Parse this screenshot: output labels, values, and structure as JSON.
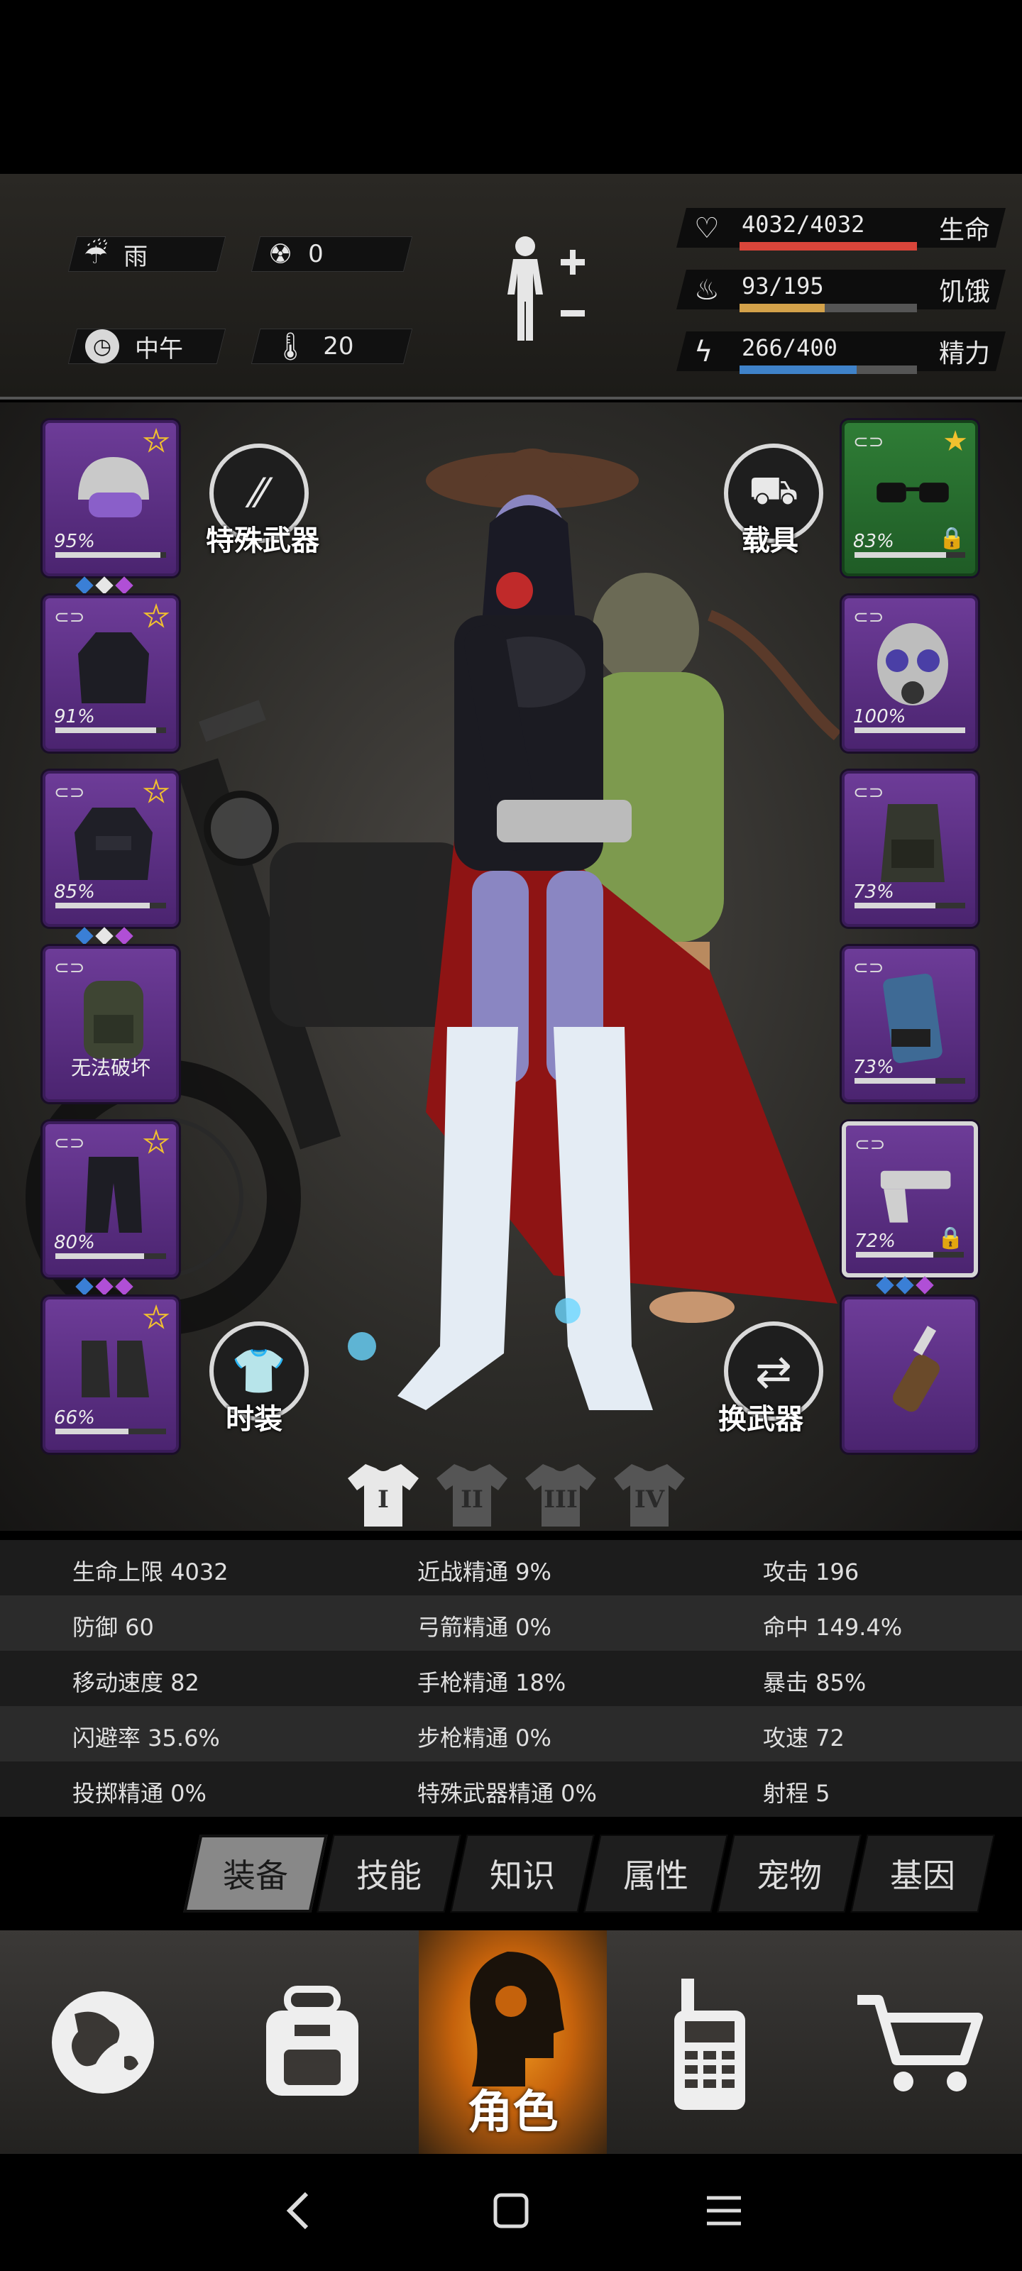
{
  "status": {
    "weather": {
      "label": "雨",
      "icon": "rain-cloud-icon"
    },
    "radiation": {
      "value": "0",
      "icon": "radiation-icon"
    },
    "time": {
      "label": "中午",
      "icon": "clock-icon"
    },
    "temperature": {
      "value": "20",
      "icon": "thermometer-icon"
    },
    "body_icon": "body-figure-icon"
  },
  "vitals": [
    {
      "icon": "heart-icon",
      "text": "4032/4032",
      "label": "生命",
      "fill": 1.0,
      "color": "#d9453a"
    },
    {
      "icon": "stomach-icon",
      "text": "93/195",
      "label": "饥饿",
      "fill": 0.48,
      "color": "#d4a24a"
    },
    {
      "icon": "energy-icon",
      "text": "266/400",
      "label": "精力",
      "fill": 0.66,
      "color": "#3f82c9"
    }
  ],
  "equipment_left": [
    {
      "name": "helmet",
      "pct": "95%",
      "durability": 0.95,
      "star": "filled",
      "gems": [
        "#3a7fd6",
        "#e6e6e6",
        "#b04fd6"
      ]
    },
    {
      "name": "jacket",
      "pct": "91%",
      "durability": 0.91,
      "star": "filled",
      "linked": true
    },
    {
      "name": "coat",
      "pct": "85%",
      "durability": 0.85,
      "star": "filled",
      "linked": true,
      "gems": [
        "#3a7fd6",
        "#e6e6e6",
        "#b04fd6"
      ]
    },
    {
      "name": "backpack",
      "broken_text": "无法破坏",
      "linked": true
    },
    {
      "name": "pants",
      "pct": "80%",
      "durability": 0.8,
      "star": "filled",
      "linked": true,
      "gems": [
        "#3a7fd6",
        "#b04fd6",
        "#b04fd6"
      ]
    },
    {
      "name": "boots",
      "pct": "66%",
      "durability": 0.66,
      "star": "filled"
    }
  ],
  "equipment_right": [
    {
      "name": "glasses",
      "pct": "83%",
      "durability": 0.83,
      "star": "filled",
      "linked": true,
      "locked": true,
      "rarity": "green"
    },
    {
      "name": "gas-mask",
      "pct": "100%",
      "durability": 1.0,
      "linked": true
    },
    {
      "name": "vest",
      "pct": "73%",
      "durability": 0.73,
      "linked": true
    },
    {
      "name": "armband",
      "pct": "73%",
      "durability": 0.73,
      "linked": true
    },
    {
      "name": "pistol",
      "pct": "72%",
      "durability": 0.72,
      "linked": true,
      "locked": true,
      "selected": true,
      "gems": [
        "#3a7fd6",
        "#3a7fd6",
        "#b04fd6"
      ]
    },
    {
      "name": "molotov"
    }
  ],
  "buttons": {
    "special_weapon": "特殊武器",
    "vehicle": "载具",
    "fashion": "时装",
    "switch_weapon": "换武器"
  },
  "outfits": [
    "I",
    "II",
    "III",
    "IV"
  ],
  "stats": [
    [
      "生命上限 4032",
      "近战精通 9%",
      "攻击 196"
    ],
    [
      "防御 60",
      "弓箭精通 0%",
      "命中 149.4%"
    ],
    [
      "移动速度 82",
      "手枪精通 18%",
      "暴击 85%"
    ],
    [
      "闪避率 35.6%",
      "步枪精通 0%",
      "攻速 72"
    ],
    [
      "投掷精通 0%",
      "特殊武器精通 0%",
      "射程 5"
    ]
  ],
  "tabs": [
    "装备",
    "技能",
    "知识",
    "属性",
    "宠物",
    "基因"
  ],
  "nav": {
    "world": "globe-icon",
    "inventory": "backpack-icon",
    "character": "角色",
    "radio": "walkie-talkie-icon",
    "shop": "cart-icon"
  },
  "system_nav": [
    "back-icon",
    "home-icon",
    "menu-icon"
  ]
}
